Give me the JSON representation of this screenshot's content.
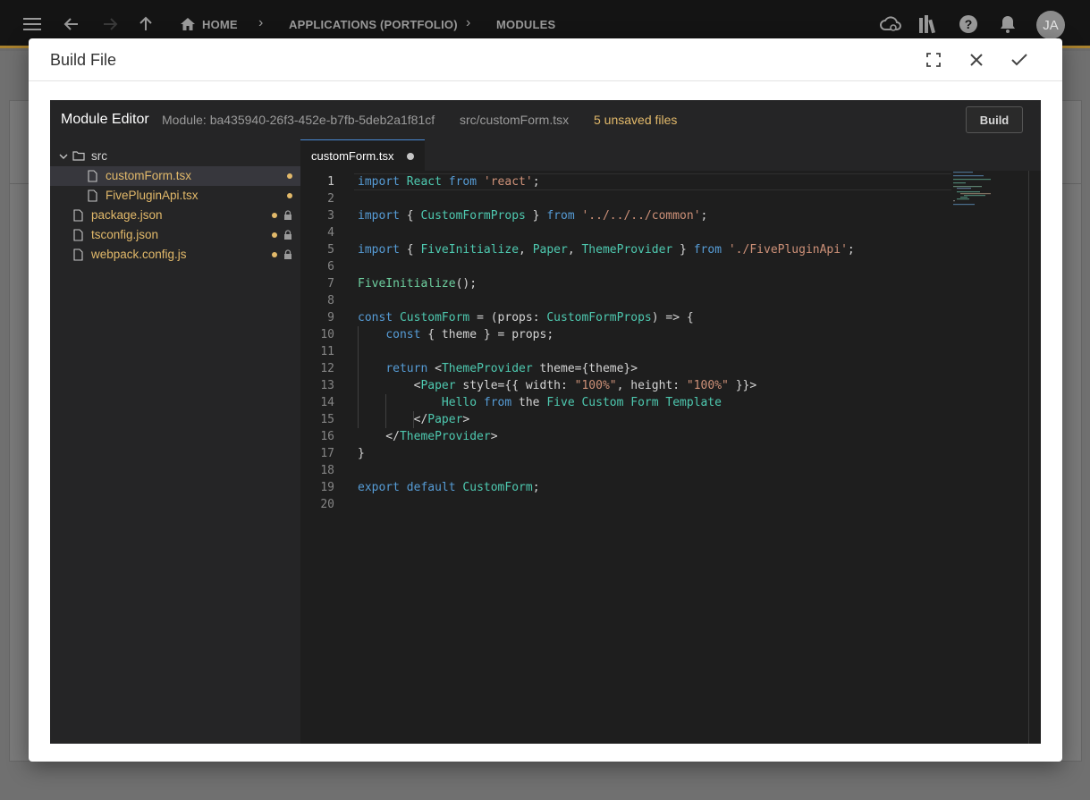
{
  "appbar": {
    "breadcrumbs": [
      "HOME",
      "APPLICATIONS (PORTFOLIO)",
      "MODULES"
    ],
    "avatar_initials": "JA"
  },
  "modal": {
    "title": "Build File"
  },
  "editor": {
    "title": "Module Editor",
    "module_label": "Module: ba435940-26f3-452e-b7fb-5deb2a1f81cf",
    "file_path": "src/customForm.tsx",
    "unsaved": "5 unsaved files",
    "build_label": "Build",
    "active_tab": "customForm.tsx",
    "tree": [
      {
        "name": "src",
        "type": "folder"
      },
      {
        "name": "customForm.tsx",
        "type": "file",
        "unsaved": true,
        "locked": false,
        "selected": true
      },
      {
        "name": "FivePluginApi.tsx",
        "type": "file",
        "unsaved": true,
        "locked": false
      },
      {
        "name": "package.json",
        "type": "file",
        "unsaved": true,
        "locked": true
      },
      {
        "name": "tsconfig.json",
        "type": "file",
        "unsaved": true,
        "locked": true
      },
      {
        "name": "webpack.config.js",
        "type": "file",
        "unsaved": true,
        "locked": true
      }
    ],
    "line_numbers": [
      "1",
      "2",
      "3",
      "4",
      "5",
      "6",
      "7",
      "8",
      "9",
      "10",
      "11",
      "12",
      "13",
      "14",
      "15",
      "16",
      "17",
      "18",
      "19",
      "20"
    ],
    "code_lines": [
      [
        [
          "kw",
          "import"
        ],
        [
          "pn",
          " "
        ],
        [
          "ty",
          "React"
        ],
        [
          "pn",
          " "
        ],
        [
          "kw",
          "from"
        ],
        [
          "pn",
          " "
        ],
        [
          "st",
          "'react'"
        ],
        [
          "pn",
          ";"
        ]
      ],
      [],
      [
        [
          "kw",
          "import"
        ],
        [
          "pn",
          " { "
        ],
        [
          "ty",
          "CustomFormProps"
        ],
        [
          "pn",
          " } "
        ],
        [
          "kw",
          "from"
        ],
        [
          "pn",
          " "
        ],
        [
          "st",
          "'../../../common'"
        ],
        [
          "pn",
          ";"
        ]
      ],
      [],
      [
        [
          "kw",
          "import"
        ],
        [
          "pn",
          " { "
        ],
        [
          "ty",
          "FiveInitialize"
        ],
        [
          "pn",
          ", "
        ],
        [
          "ty",
          "Paper"
        ],
        [
          "pn",
          ", "
        ],
        [
          "ty",
          "ThemeProvider"
        ],
        [
          "pn",
          " } "
        ],
        [
          "kw",
          "from"
        ],
        [
          "pn",
          " "
        ],
        [
          "st",
          "'./FivePluginApi'"
        ],
        [
          "pn",
          ";"
        ]
      ],
      [],
      [
        [
          "fn",
          "FiveInitialize"
        ],
        [
          "pn",
          "();"
        ]
      ],
      [],
      [
        [
          "kw",
          "const"
        ],
        [
          "pn",
          " "
        ],
        [
          "ty",
          "CustomForm"
        ],
        [
          "pn",
          " = (props: "
        ],
        [
          "ty",
          "CustomFormProps"
        ],
        [
          "pn",
          ") => {"
        ]
      ],
      [
        [
          "pn",
          "    "
        ],
        [
          "kw",
          "const"
        ],
        [
          "pn",
          " { theme } = props;"
        ]
      ],
      [],
      [
        [
          "pn",
          "    "
        ],
        [
          "kw",
          "return"
        ],
        [
          "pn",
          " <"
        ],
        [
          "ty",
          "ThemeProvider"
        ],
        [
          "pn",
          " theme={theme}>"
        ]
      ],
      [
        [
          "pn",
          "        <"
        ],
        [
          "ty",
          "Paper"
        ],
        [
          "pn",
          " style={{ width: "
        ],
        [
          "st",
          "\"100%\""
        ],
        [
          "pn",
          ", height: "
        ],
        [
          "st",
          "\"100%\""
        ],
        [
          "pn",
          " }}>"
        ]
      ],
      [
        [
          "pn",
          "            "
        ],
        [
          "ty",
          "Hello"
        ],
        [
          "pn",
          " "
        ],
        [
          "kw",
          "from"
        ],
        [
          "pn",
          " the "
        ],
        [
          "ty",
          "Five Custom Form Template"
        ]
      ],
      [
        [
          "pn",
          "        </"
        ],
        [
          "ty",
          "Paper"
        ],
        [
          "pn",
          ">"
        ]
      ],
      [
        [
          "pn",
          "    </"
        ],
        [
          "ty",
          "ThemeProvider"
        ],
        [
          "pn",
          ">"
        ]
      ],
      [
        [
          "pn",
          "}"
        ]
      ],
      [],
      [
        [
          "kw",
          "export"
        ],
        [
          "pn",
          " "
        ],
        [
          "kw",
          "default"
        ],
        [
          "pn",
          " "
        ],
        [
          "ty",
          "CustomForm"
        ],
        [
          "pn",
          ";"
        ]
      ],
      []
    ]
  }
}
